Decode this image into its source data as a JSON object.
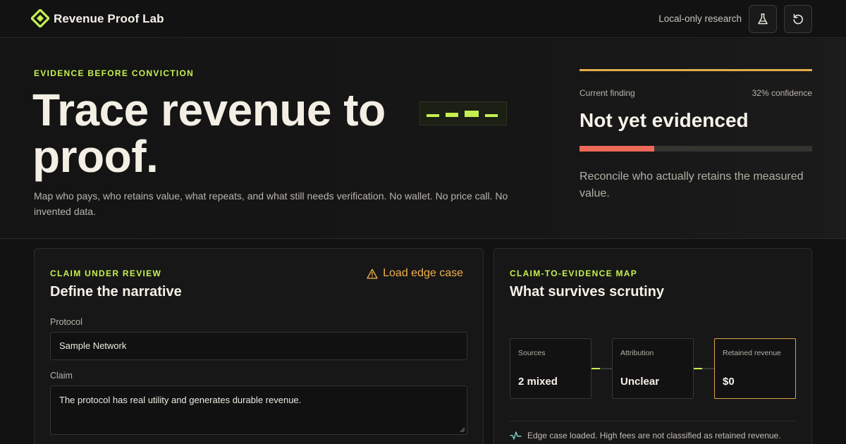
{
  "header": {
    "brand": "Revenue Proof Lab",
    "mode_label": "Local-only research",
    "icons": {
      "logo": "diamond-logo-icon",
      "flask": "flask-icon",
      "reset": "reset-icon"
    }
  },
  "hero": {
    "eyebrow": "EVIDENCE BEFORE CONVICTION",
    "title_line1": "Trace revenue to",
    "title_line2": "proof.",
    "description": "Map who pays, who retains value, what repeats, and what still needs verification. No wallet. No price call. No invented data."
  },
  "finding": {
    "label": "Current finding",
    "confidence_text": "32% confidence",
    "confidence": 0.32,
    "title": "Not yet evidenced",
    "note": "Reconcile who actually retains the measured value."
  },
  "claim_panel": {
    "eyebrow": "CLAIM UNDER REVIEW",
    "title": "Define the narrative",
    "edge_case_link": "Load edge case",
    "protocol_label": "Protocol",
    "protocol_value": "Sample Network",
    "claim_label": "Claim",
    "claim_value": "The protocol has real utility and generates durable revenue."
  },
  "map_panel": {
    "eyebrow": "CLAIM-TO-EVIDENCE MAP",
    "title": "What survives scrutiny",
    "nodes": [
      {
        "label": "Sources",
        "value": "2 mixed"
      },
      {
        "label": "Attribution",
        "value": "Unclear"
      },
      {
        "label": "Retained revenue",
        "value": "$0"
      }
    ],
    "note": "Edge case loaded. High fees are not classified as retained revenue."
  },
  "colors": {
    "accent": "#c6f04f",
    "warning": "#f0b04b",
    "danger": "#ee6a58",
    "background": "#121212"
  }
}
